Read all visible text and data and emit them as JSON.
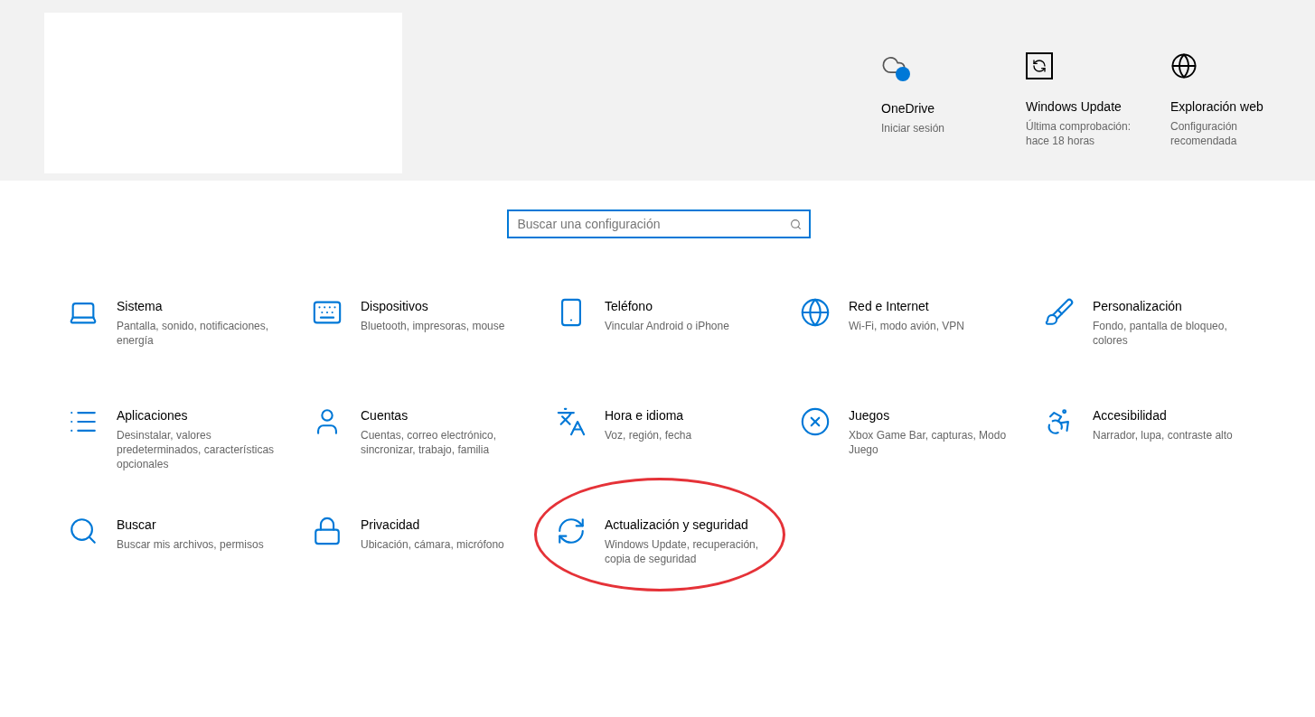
{
  "quick_links": [
    {
      "title": "OneDrive",
      "subtitle": "Iniciar sesión"
    },
    {
      "title": "Windows Update",
      "subtitle": "Última comprobación: hace 18 horas"
    },
    {
      "title": "Exploración web",
      "subtitle": "Configuración recomendada"
    }
  ],
  "search": {
    "placeholder": "Buscar una configuración"
  },
  "categories": [
    {
      "title": "Sistema",
      "subtitle": "Pantalla, sonido, notificaciones, energía",
      "circled": false
    },
    {
      "title": "Dispositivos",
      "subtitle": "Bluetooth, impresoras, mouse",
      "circled": false
    },
    {
      "title": "Teléfono",
      "subtitle": "Vincular Android o iPhone",
      "circled": false
    },
    {
      "title": "Red e Internet",
      "subtitle": "Wi-Fi, modo avión, VPN",
      "circled": false
    },
    {
      "title": "Personalización",
      "subtitle": "Fondo, pantalla de bloqueo, colores",
      "circled": false
    },
    {
      "title": "Aplicaciones",
      "subtitle": "Desinstalar, valores predeterminados, características opcionales",
      "circled": false
    },
    {
      "title": "Cuentas",
      "subtitle": "Cuentas, correo electrónico, sincronizar, trabajo, familia",
      "circled": false
    },
    {
      "title": "Hora e idioma",
      "subtitle": "Voz, región, fecha",
      "circled": false
    },
    {
      "title": "Juegos",
      "subtitle": "Xbox Game Bar, capturas, Modo Juego",
      "circled": false
    },
    {
      "title": "Accesibilidad",
      "subtitle": "Narrador, lupa, contraste alto",
      "circled": false
    },
    {
      "title": "Buscar",
      "subtitle": "Buscar mis archivos, permisos",
      "circled": false
    },
    {
      "title": "Privacidad",
      "subtitle": "Ubicación, cámara, micrófono",
      "circled": false
    },
    {
      "title": "Actualización y seguridad",
      "subtitle": "Windows Update, recuperación, copia de seguridad",
      "circled": true
    }
  ]
}
